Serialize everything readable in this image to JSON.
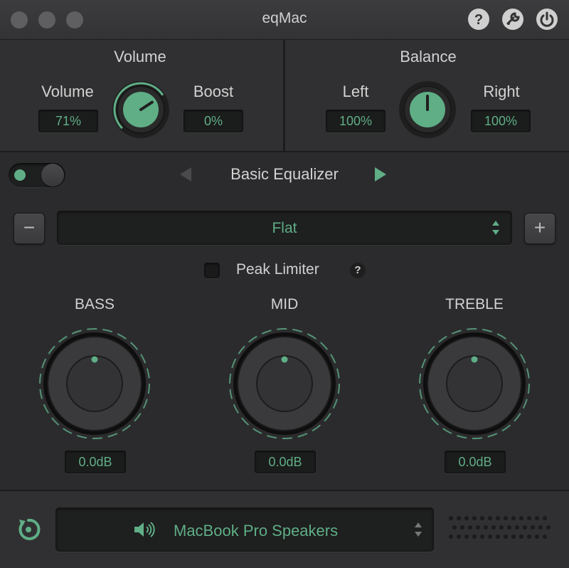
{
  "window": {
    "title": "eqMac",
    "icons": [
      "help-icon",
      "settings-icon",
      "power-icon"
    ]
  },
  "volume": {
    "section_title": "Volume",
    "volume_label": "Volume",
    "volume_value": "71%",
    "boost_label": "Boost",
    "boost_value": "0%",
    "knob_level": 0.71
  },
  "balance": {
    "section_title": "Balance",
    "left_label": "Left",
    "left_value": "100%",
    "right_label": "Right",
    "right_value": "100%",
    "knob_level": 0.5
  },
  "equalizer": {
    "enabled": true,
    "title": "Basic Equalizer",
    "preset": "Flat",
    "remove_glyph": "−",
    "add_glyph": "+",
    "peak_limiter_label": "Peak Limiter",
    "peak_limiter_checked": false,
    "help_glyph": "?",
    "bands": [
      {
        "label": "BASS",
        "value": "0.0dB"
      },
      {
        "label": "MID",
        "value": "0.0dB"
      },
      {
        "label": "TREBLE",
        "value": "0.0dB"
      }
    ]
  },
  "output": {
    "device": "MacBook Pro Speakers"
  },
  "colors": {
    "accent": "#5fae86",
    "background": "#2b2b2d",
    "panel": "#303032"
  }
}
